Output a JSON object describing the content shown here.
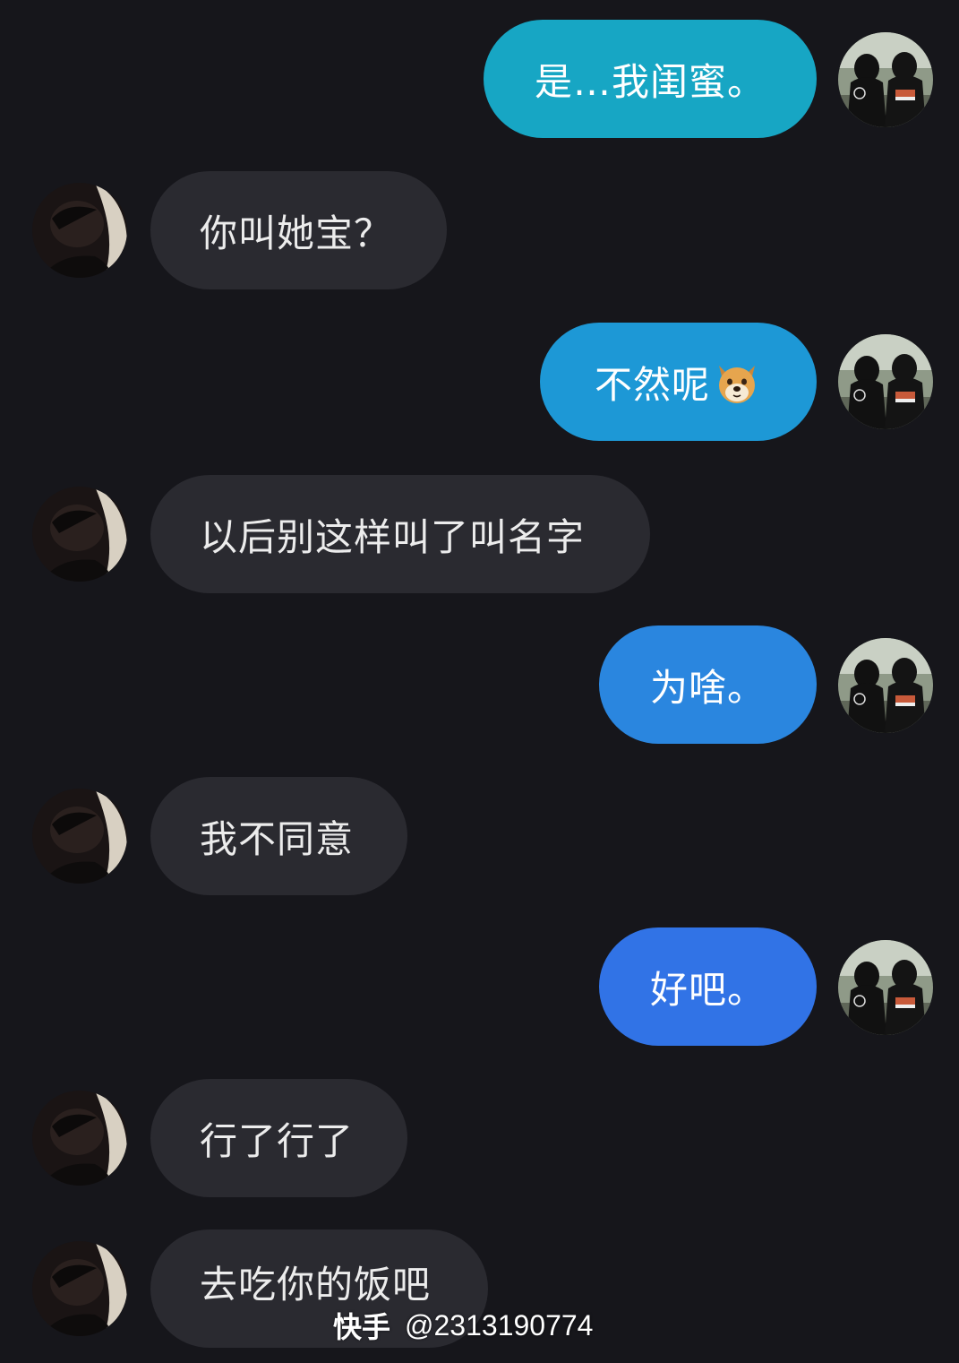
{
  "conversation": {
    "messages": [
      {
        "sender": "me",
        "text": "是…我闺蜜。"
      },
      {
        "sender": "them",
        "text": "你叫她宝？"
      },
      {
        "sender": "me",
        "text": "不然呢",
        "emoji": "doge"
      },
      {
        "sender": "them",
        "text": "以后别这样叫了叫名字"
      },
      {
        "sender": "me",
        "text": "为啥。"
      },
      {
        "sender": "them",
        "text": "我不同意"
      },
      {
        "sender": "me",
        "text": "好吧。"
      },
      {
        "sender": "them",
        "text": "行了行了"
      },
      {
        "sender": "them",
        "text": "去吃你的饭吧"
      }
    ]
  },
  "watermark": {
    "brand": "快手",
    "handle": "@2313190774"
  },
  "colors": {
    "background": "#16161b",
    "incoming_bubble": "#2a2a30",
    "outgoing_gradient": [
      "#17a6c4",
      "#1d98d6",
      "#2a86df",
      "#3173e6"
    ]
  },
  "icons": {
    "emoji": "doge-emoji-icon",
    "me_avatar": "couple-avatar-icon",
    "them_avatar": "dark-portrait-avatar-icon"
  }
}
